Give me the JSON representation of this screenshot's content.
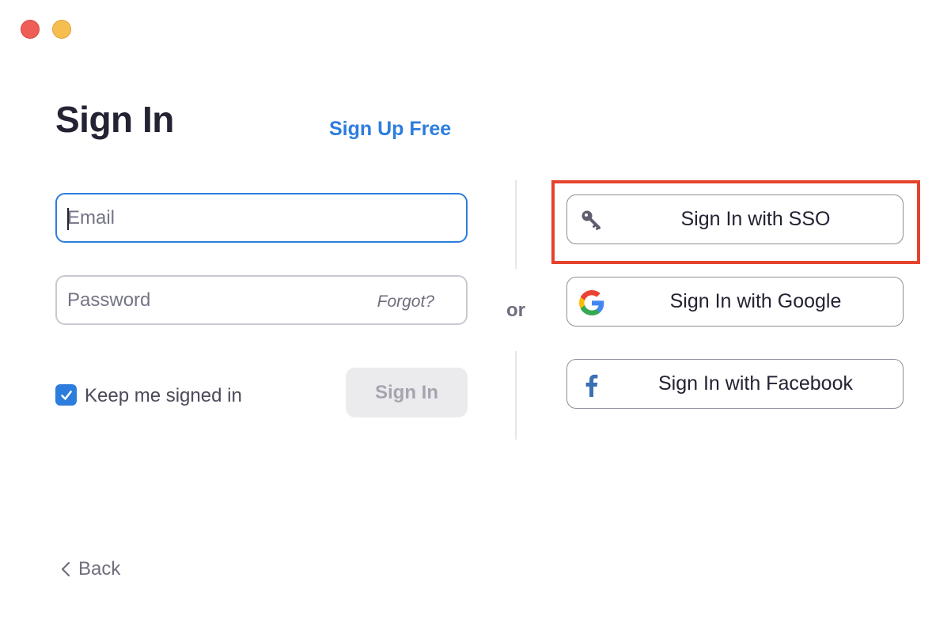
{
  "window": {
    "controls": [
      "close",
      "minimize"
    ]
  },
  "header": {
    "title": "Sign In",
    "signup_link": "Sign Up Free"
  },
  "form": {
    "email": {
      "placeholder": "Email",
      "value": ""
    },
    "password": {
      "placeholder": "Password",
      "value": ""
    },
    "forgot_label": "Forgot?",
    "keep_signed_in": {
      "label": "Keep me signed in",
      "checked": true
    },
    "submit_label": "Sign In"
  },
  "separator": {
    "label": "or"
  },
  "providers": [
    {
      "label": "Sign In with SSO",
      "icon": "key-icon",
      "highlighted": true
    },
    {
      "label": "Sign In with Google",
      "icon": "google-icon",
      "highlighted": false
    },
    {
      "label": "Sign In with Facebook",
      "icon": "facebook-icon",
      "highlighted": false
    }
  ],
  "footer": {
    "back_label": "Back",
    "back_icon": "chevron-left-icon"
  },
  "colors": {
    "accent": "#2d7ddd",
    "title": "#232333",
    "highlight": "#e5432d",
    "close": "#ee5e57",
    "minimize": "#f5be4f"
  }
}
